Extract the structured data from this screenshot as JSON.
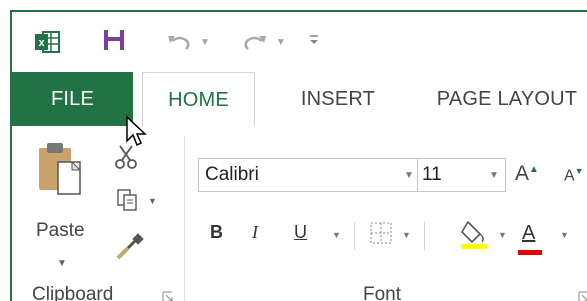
{
  "quick_access": {
    "app_icon": "excel-icon",
    "save_icon": "save-icon",
    "undo_icon": "undo-icon",
    "redo_icon": "redo-icon",
    "customize_icon": "customize-qat-icon"
  },
  "tabs": [
    {
      "label": "FILE"
    },
    {
      "label": "HOME"
    },
    {
      "label": "INSERT"
    },
    {
      "label": "PAGE LAYOUT"
    }
  ],
  "clipboard": {
    "paste_label": "Paste",
    "group_label": "Clipboard"
  },
  "font": {
    "font_name": "Calibri",
    "font_size": "11",
    "bold_label": "B",
    "italic_label": "I",
    "underline_label": "U",
    "font_color_label": "A",
    "grow_label": "A",
    "shrink_label": "A",
    "group_label": "Font"
  },
  "colors": {
    "accent": "#217346",
    "highlight": "#ffff00",
    "font_color": "#e00000"
  }
}
